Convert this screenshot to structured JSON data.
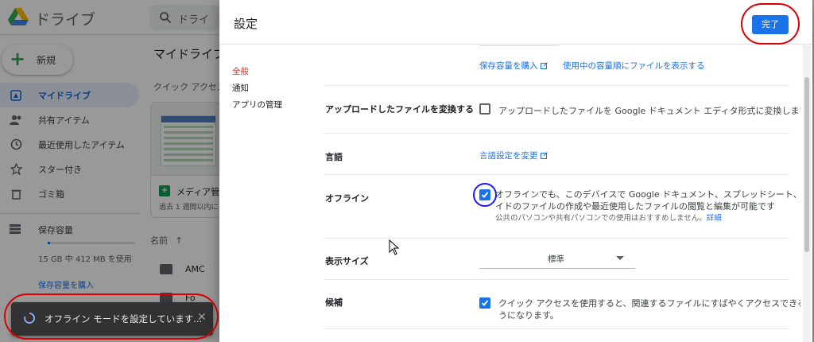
{
  "app": {
    "logo_text": "ドライブ",
    "search_placeholder": "ドライ",
    "new_label": "新規"
  },
  "sidebar": {
    "items": [
      {
        "label": "マイドライブ",
        "icon": "my-drive-icon",
        "active": true
      },
      {
        "label": "共有アイテム",
        "icon": "shared-icon",
        "active": false
      },
      {
        "label": "最近使用したアイテム",
        "icon": "clock-icon",
        "active": false
      },
      {
        "label": "スター付き",
        "icon": "star-icon",
        "active": false
      },
      {
        "label": "ゴミ箱",
        "icon": "trash-icon",
        "active": false
      }
    ],
    "storage_label": "保存容量",
    "storage_used": "15 GB 中 412 MB を使用",
    "storage_buy": "保存容量を購入",
    "storage_fraction": 0.03
  },
  "main": {
    "title": "マイドライブ",
    "quick_access": "クイック アクセス",
    "card_name": "メディア管",
    "card_sub": "過去 1 週間以内に",
    "list_header": "名前",
    "files": [
      "AMC",
      "Fo"
    ]
  },
  "toast": {
    "text": "オフライン モードを設定しています...",
    "close": "✕"
  },
  "dialog": {
    "title": "設定",
    "done_label": "完了",
    "nav": [
      "全般",
      "通知",
      "アプリの管理"
    ],
    "storage_links": [
      "保存容量を購入",
      "使用中の容量順にファイルを表示する"
    ],
    "convert": {
      "label": "アップロードしたファイルを変換する",
      "text": "アップロードしたファイルを Google ドキュメント エディタ形式に変換します",
      "checked": false
    },
    "language": {
      "label": "言語",
      "link": "言語設定を変更"
    },
    "offline": {
      "label": "オフライン",
      "line1": "オフラインでも、このデバイスで Google ドキュメント、スプレッドシート、スラ",
      "line2": "イドのファイルの作成や最近使用したファイルの閲覧と編集が可能です",
      "note": "公共のパソコンや共有パソコンでの使用はおすすめしません。",
      "details": "詳細",
      "checked": true
    },
    "density": {
      "label": "表示サイズ",
      "value": "標準"
    },
    "suggestions": {
      "label": "候補",
      "line1": "クイック アクセスを使用すると、関連するファイルにすばやくアクセスできるよ",
      "line2": "うになります。",
      "checked": true
    }
  },
  "colors": {
    "accent": "#1a73e8",
    "highlight_red": "#d80000",
    "highlight_blue": "#1a1aff"
  }
}
